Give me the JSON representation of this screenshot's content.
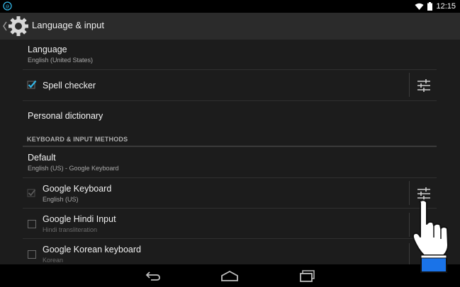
{
  "status_bar": {
    "time": "12:15",
    "icons": [
      "notification-icon",
      "wifi-icon",
      "battery-icon"
    ]
  },
  "action_bar": {
    "title": "Language & input",
    "icon": "settings-gear-icon"
  },
  "rows": {
    "language": {
      "title": "Language",
      "summary": "English (United States)"
    },
    "spell_checker": {
      "title": "Spell checker",
      "checked": true
    },
    "personal_dictionary": {
      "title": "Personal dictionary"
    },
    "section_header": "KEYBOARD & INPUT METHODS",
    "default": {
      "title": "Default",
      "summary": "English (US) - Google Keyboard"
    },
    "google_keyboard": {
      "title": "Google Keyboard",
      "summary": "English (US)",
      "checked": true,
      "enabled": false
    },
    "google_hindi": {
      "title": "Google Hindi Input",
      "summary": "Hindi transliteration",
      "checked": false
    },
    "google_korean": {
      "title": "Google Korean keyboard",
      "summary": "Korean",
      "checked": false
    }
  },
  "colors": {
    "accent": "#33b5e5",
    "background": "#1c1c1c",
    "action_bar": "#2b2b2b"
  },
  "nav_bar": [
    "back-icon",
    "home-icon",
    "recent-apps-icon"
  ]
}
